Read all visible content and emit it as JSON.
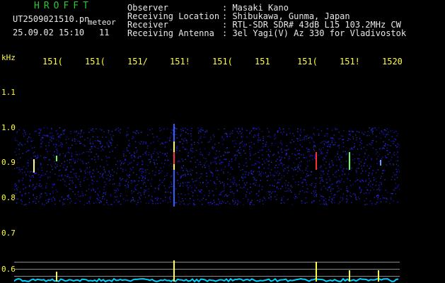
{
  "header": {
    "logo": "HROFFT",
    "filename": "UT2509021510.pn",
    "mode": "meteor",
    "datetime": "25.09.02 15:10",
    "count": "11",
    "labels": {
      "observer": "Observer",
      "location": "Receiving Location",
      "receiver": "Receiver",
      "antenna": "Receiving Antenna"
    },
    "values": {
      "observer": ": Masaki Kano",
      "location": ": Shibukawa, Gunma, Japan",
      "receiver": ": RTL-SDR SDR# 43dB L15 103.2MHz CW",
      "antenna": ": 3el Yagi(V) Az 330 for Vladivostok"
    }
  },
  "axis": {
    "unit": "kHz",
    "y_ticks": [
      "1.1",
      "1.0",
      "0.9",
      "0.8",
      "0.7",
      "0.6"
    ],
    "x_ticks": [
      "151(",
      "151(",
      "151/",
      "151!",
      "151(",
      "151",
      "151(",
      "151!",
      "1520"
    ]
  },
  "colors": {
    "background": "#000000",
    "noise": "#1a2a9a",
    "meteor_core": "#ff3030",
    "meteor_edge": "#ffff40",
    "baseline": "#00d0ff"
  }
}
